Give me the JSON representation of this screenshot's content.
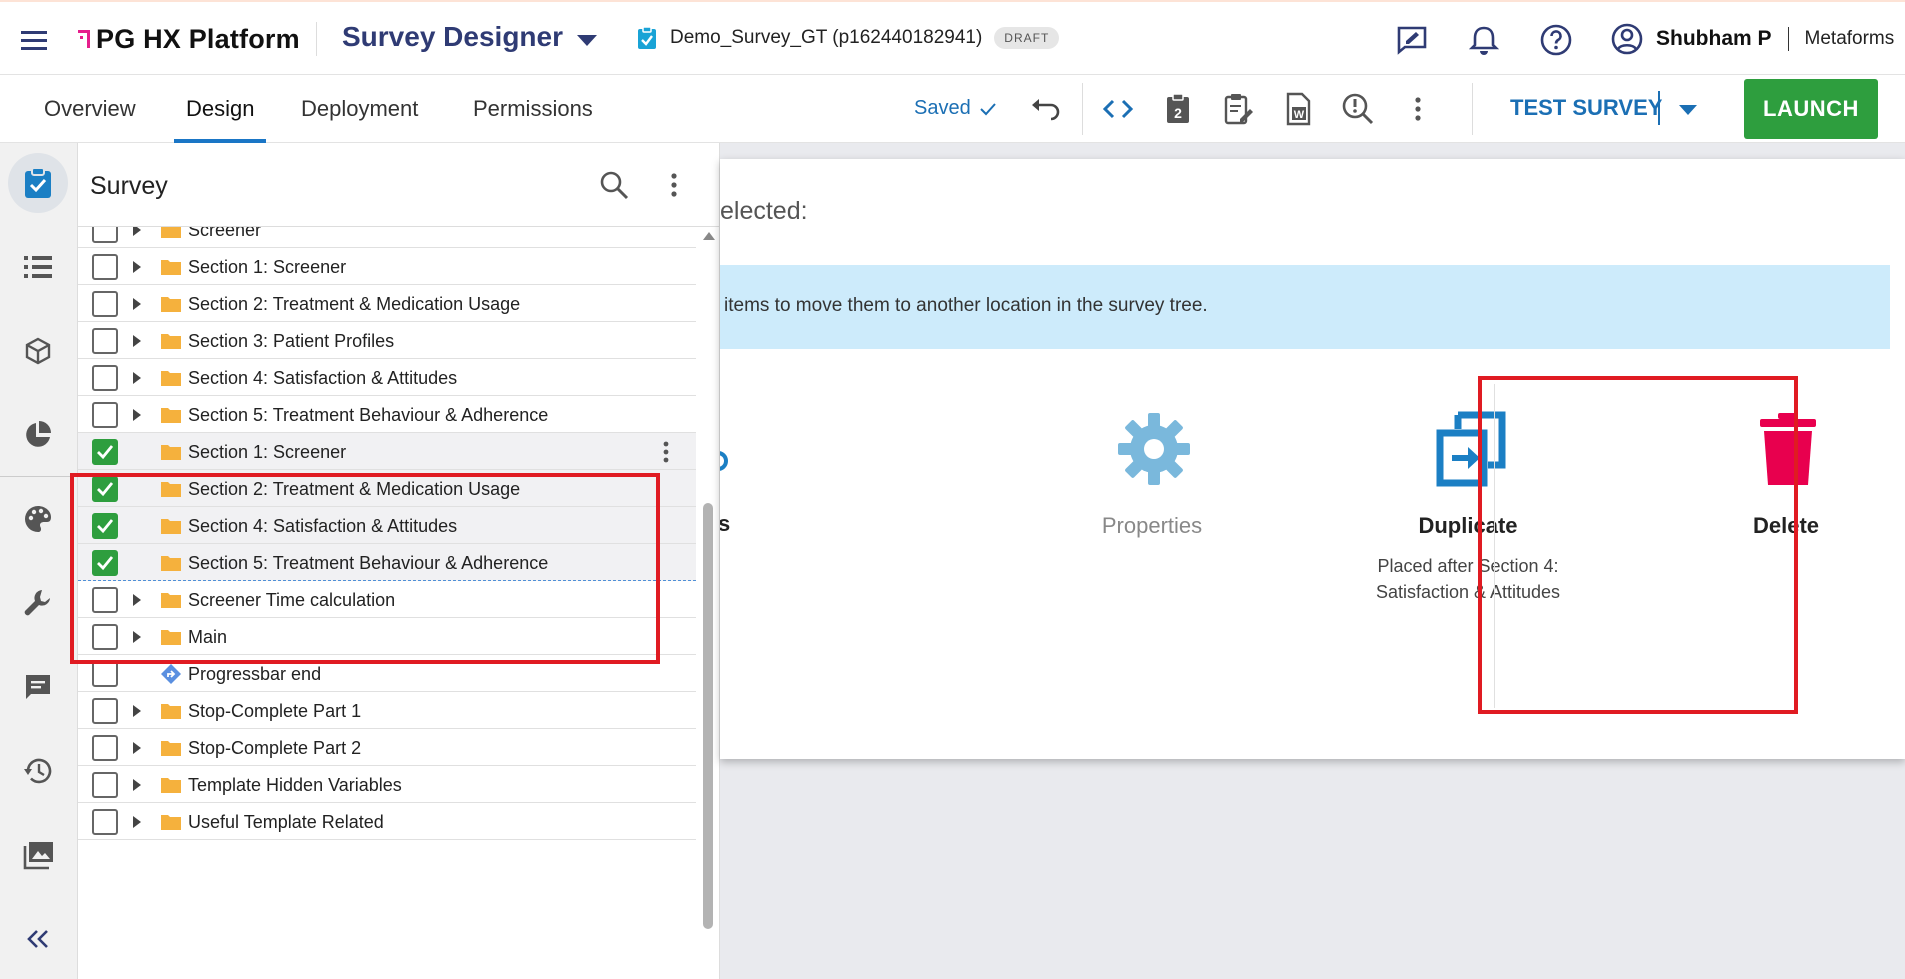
{
  "header": {
    "brand": "PG HX Platform",
    "app_name": "Survey Designer",
    "survey_name": "Demo_Survey_GT (p162440182941)",
    "status_badge": "DRAFT",
    "user_name": "Shubham P",
    "org_name": "Metaforms"
  },
  "tabs": [
    {
      "label": "Overview",
      "active": false
    },
    {
      "label": "Design",
      "active": true
    },
    {
      "label": "Deployment",
      "active": false
    },
    {
      "label": "Permissions",
      "active": false
    }
  ],
  "toolbar": {
    "saved_label": "Saved",
    "test_survey_label": "TEST SURVEY",
    "launch_label": "LAUNCH"
  },
  "tree": {
    "title": "Survey",
    "items": [
      {
        "label": "Screener",
        "type": "folder",
        "checked": false,
        "expandable": true
      },
      {
        "label": "Section 1: Screener",
        "type": "folder",
        "checked": false,
        "expandable": true
      },
      {
        "label": "Section 2: Treatment & Medication Usage",
        "type": "folder",
        "checked": false,
        "expandable": true
      },
      {
        "label": "Section 3: Patient Profiles",
        "type": "folder",
        "checked": false,
        "expandable": true
      },
      {
        "label": "Section 4: Satisfaction & Attitudes",
        "type": "folder",
        "checked": false,
        "expandable": true
      },
      {
        "label": "Section 5: Treatment Behaviour & Adherence",
        "type": "folder",
        "checked": false,
        "expandable": true
      },
      {
        "label": "Section 1: Screener",
        "type": "folder",
        "checked": true,
        "expandable": false
      },
      {
        "label": "Section 2: Treatment & Medication Usage",
        "type": "folder",
        "checked": true,
        "expandable": false
      },
      {
        "label": "Section 4: Satisfaction & Attitudes",
        "type": "folder",
        "checked": true,
        "expandable": false
      },
      {
        "label": "Section 5: Treatment Behaviour & Adherence",
        "type": "folder",
        "checked": true,
        "expandable": false
      },
      {
        "label": "Screener Time calculation",
        "type": "folder",
        "checked": false,
        "expandable": true
      },
      {
        "label": "Main",
        "type": "folder",
        "checked": false,
        "expandable": true
      },
      {
        "label": "Progressbar end",
        "type": "logic",
        "checked": false,
        "expandable": false
      },
      {
        "label": "Stop-Complete Part 1",
        "type": "folder",
        "checked": false,
        "expandable": true
      },
      {
        "label": "Stop-Complete Part 2",
        "type": "folder",
        "checked": false,
        "expandable": true
      },
      {
        "label": "Template Hidden Variables",
        "type": "folder",
        "checked": false,
        "expandable": true
      },
      {
        "label": "Useful Template Related",
        "type": "folder",
        "checked": false,
        "expandable": true
      }
    ]
  },
  "dialog": {
    "heading_partial": "elected:",
    "info_text_partial": "items to move them to another location in the survey tree.",
    "partial_action_title": "s",
    "actions": [
      {
        "title": "Properties",
        "subtitle": "",
        "icon": "gear-icon",
        "color": "#7ab8dc",
        "enabled": false
      },
      {
        "title": "Duplicate",
        "subtitle": "Placed after Section 4: Satisfaction & Attitudes",
        "icon": "duplicate-icon",
        "color": "#1b7fc4",
        "enabled": true
      },
      {
        "title": "Delete",
        "subtitle": "",
        "icon": "trash-icon",
        "color": "#e8004e",
        "enabled": true
      }
    ]
  },
  "colors": {
    "brand_navy": "#2f3b74",
    "accent_blue": "#1b6fb4",
    "launch_green": "#2e9e3e",
    "checkbox_green": "#2e9e3e",
    "highlight_red": "#e01b22",
    "delete_pink": "#e8004e",
    "info_bg": "#cdebfb",
    "folder_orange": "#f5b13d"
  }
}
